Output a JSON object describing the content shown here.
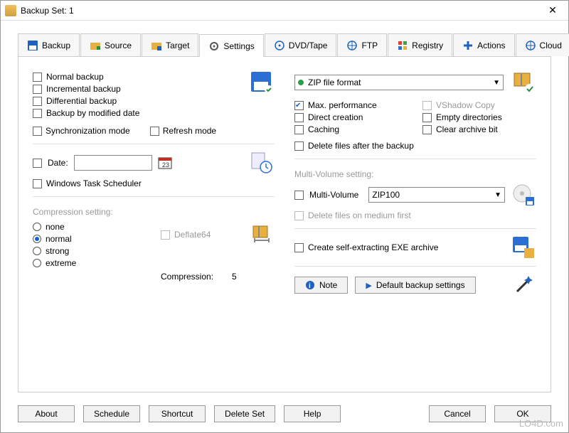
{
  "window": {
    "title": "Backup Set: 1"
  },
  "tabs": {
    "backup": "Backup",
    "source": "Source",
    "target": "Target",
    "settings": "Settings",
    "dvd": "DVD/Tape",
    "ftp": "FTP",
    "registry": "Registry",
    "actions": "Actions",
    "cloud": "Cloud"
  },
  "left": {
    "normal_backup": "Normal backup",
    "incremental_backup": "Incremental backup",
    "differential_backup": "Differential backup",
    "backup_modified": "Backup by modified  date",
    "sync_mode": "Synchronization mode",
    "refresh_mode": "Refresh mode",
    "date_label": "Date:",
    "date_value": "",
    "task_scheduler": "Windows Task Scheduler",
    "compression_header": "Compression setting:",
    "comp_none": "none",
    "comp_normal": "normal",
    "comp_strong": "strong",
    "comp_extreme": "extreme",
    "deflate64": "Deflate64",
    "compression_label": "Compression:",
    "compression_value": "5"
  },
  "right": {
    "zip_format": "ZIP file format",
    "max_perf": "Max. performance",
    "vshadow": "VShadow Copy",
    "direct_creation": "Direct creation",
    "empty_dirs": "Empty directories",
    "caching": "Caching",
    "clear_archive": "Clear archive bit",
    "delete_after": "Delete files after the backup",
    "multivol_header": "Multi-Volume setting:",
    "multivol_label": "Multi-Volume",
    "multivol_value": "ZIP100",
    "delete_medium": "Delete files on medium first",
    "self_extract": "Create self-extracting EXE archive",
    "note_btn": "Note",
    "default_btn": "Default backup settings"
  },
  "bottom": {
    "about": "About",
    "schedule": "Schedule",
    "shortcut": "Shortcut",
    "delete_set": "Delete Set",
    "help": "Help",
    "cancel": "Cancel",
    "ok": "OK"
  },
  "watermark": "LO4D.com"
}
